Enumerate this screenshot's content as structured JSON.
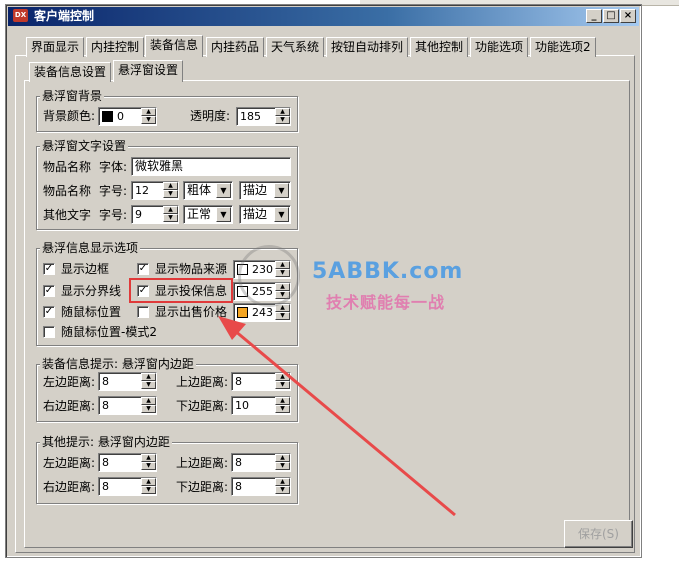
{
  "window": {
    "title": "客户端控制",
    "app_icon_text": "DX",
    "btn_min": "_",
    "btn_max": "□",
    "btn_close": "×"
  },
  "tabs": [
    {
      "label": "界面显示"
    },
    {
      "label": "内挂控制"
    },
    {
      "label": "装备信息",
      "active": true
    },
    {
      "label": "内挂药品"
    },
    {
      "label": "天气系统"
    },
    {
      "label": "按钮自动排列"
    },
    {
      "label": "其他控制"
    },
    {
      "label": "功能选项"
    },
    {
      "label": "功能选项2"
    }
  ],
  "subtabs": [
    {
      "label": "装备信息设置"
    },
    {
      "label": "悬浮窗设置",
      "active": true
    }
  ],
  "bg_group": {
    "legend": "悬浮窗背景",
    "color_label": "背景颜色:",
    "color_value": "0",
    "color_hex": "#000000",
    "opacity_label": "透明度:",
    "opacity_value": "185"
  },
  "text_group": {
    "legend": "悬浮窗文字设置",
    "row1": {
      "prefix": "物品名称",
      "field": "字体:",
      "value": "微软雅黑"
    },
    "row2": {
      "prefix": "物品名称",
      "field": "字号:",
      "size": "12",
      "weight": "粗体",
      "effect": "描边"
    },
    "row3": {
      "prefix": "其他文字",
      "field": "字号:",
      "size": "9",
      "weight": "正常",
      "effect": "描边"
    }
  },
  "display_group": {
    "legend": "悬浮信息显示选项",
    "col1": [
      {
        "label": "显示边框",
        "checked": true
      },
      {
        "label": "显示分界线",
        "checked": true
      },
      {
        "label": "随鼠标位置",
        "checked": true
      },
      {
        "label": "随鼠标位置-模式2",
        "checked": false
      }
    ],
    "col2": [
      {
        "label": "显示物品来源",
        "checked": true,
        "value": "230",
        "color": "#ffffff"
      },
      {
        "label": "显示投保信息",
        "checked": true,
        "value": "255",
        "color": "#ffffff"
      },
      {
        "label": "显示出售价格",
        "checked": false,
        "value": "243",
        "color": "#f5a623"
      }
    ]
  },
  "equip_padding": {
    "legend": "装备信息提示: 悬浮窗内边距",
    "left_label": "左边距离:",
    "left": "8",
    "top_label": "上边距离:",
    "top": "8",
    "right_label": "右边距离:",
    "right": "8",
    "bottom_label": "下边距离:",
    "bottom": "10"
  },
  "other_padding": {
    "legend": "其他提示: 悬浮窗内边距",
    "left_label": "左边距离:",
    "left": "8",
    "top_label": "上边距离:",
    "top": "8",
    "right_label": "右边距离:",
    "right": "8",
    "bottom_label": "下边距离:",
    "bottom": "8"
  },
  "save_label": "保存(S)",
  "watermark": {
    "site": "5ABBK.com",
    "slogan": "技术赋能每一战"
  },
  "icons": {
    "check": "✓",
    "up": "▲",
    "down": "▼",
    "combo": "▼"
  }
}
